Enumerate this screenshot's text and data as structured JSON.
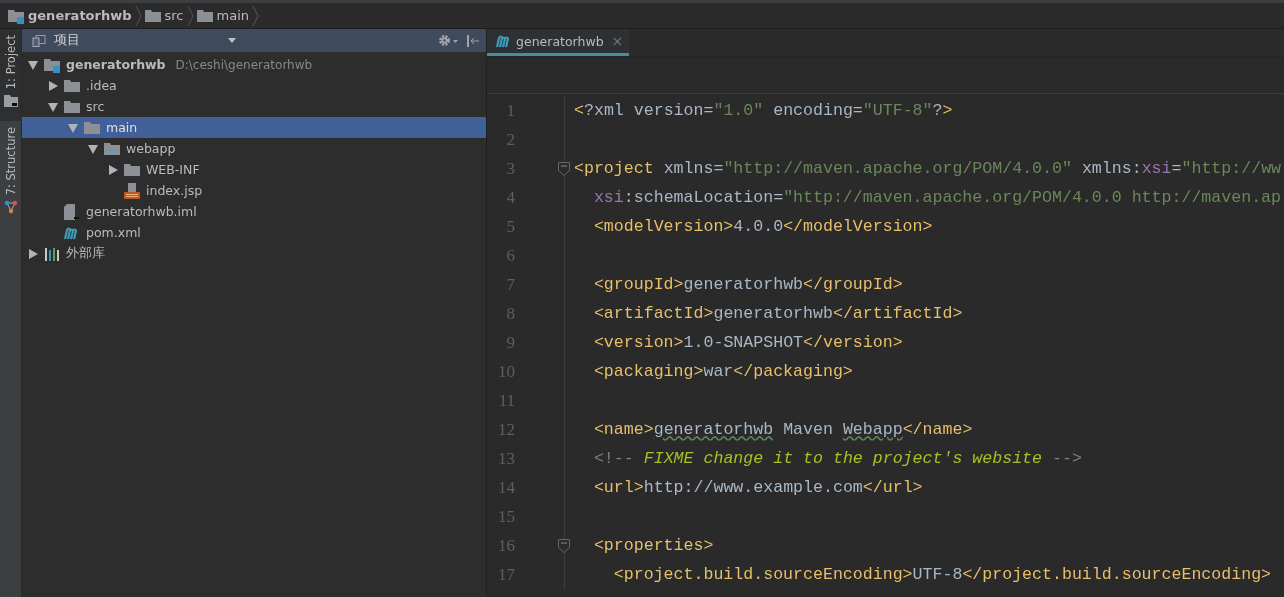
{
  "breadcrumbs": [
    {
      "label": "generatorhwb",
      "kind": "module"
    },
    {
      "label": "src",
      "kind": "folder"
    },
    {
      "label": "main",
      "kind": "folder"
    }
  ],
  "tool_stripe": [
    {
      "label": "1: Project",
      "kind": "project",
      "selected": true
    },
    {
      "label": "7: Structure",
      "kind": "structure",
      "selected": false
    }
  ],
  "project_panel": {
    "title": "项目",
    "tree": [
      {
        "label": "generatorhwb",
        "path": "D:\\ceshi\\generatorhwb",
        "kind": "module",
        "expanded": true,
        "selected": false,
        "children": [
          {
            "label": ".idea",
            "kind": "folder",
            "expanded": false,
            "selected": false
          },
          {
            "label": "src",
            "kind": "folder",
            "expanded": true,
            "selected": false,
            "children": [
              {
                "label": "main",
                "kind": "folder",
                "expanded": true,
                "selected": true,
                "children": [
                  {
                    "label": "webapp",
                    "kind": "webfolder",
                    "expanded": true,
                    "selected": false,
                    "children": [
                      {
                        "label": "WEB-INF",
                        "kind": "folder",
                        "expanded": false,
                        "selected": false
                      },
                      {
                        "label": "index.jsp",
                        "kind": "jsp",
                        "selected": false
                      }
                    ]
                  }
                ]
              }
            ]
          },
          {
            "label": "generatorhwb.iml",
            "kind": "file",
            "selected": false
          },
          {
            "label": "pom.xml",
            "kind": "maven",
            "selected": false
          }
        ]
      },
      {
        "label": "外部库",
        "kind": "library",
        "expanded": false,
        "selected": false
      }
    ]
  },
  "editor": {
    "tabs": [
      {
        "label": "generatorhwb",
        "close": "×",
        "selected": true
      }
    ],
    "lines": [
      {
        "number": "1",
        "tokens": [
          {
            "kind": "tag",
            "text": "<"
          },
          {
            "kind": "text",
            "text": "?xml version="
          },
          {
            "kind": "str",
            "text": "\"1.0\""
          },
          {
            "kind": "text",
            "text": " encoding="
          },
          {
            "kind": "str",
            "text": "\"UTF-8\""
          },
          {
            "kind": "text",
            "text": "?"
          },
          {
            "kind": "tag",
            "text": ">"
          }
        ]
      },
      {
        "number": "2"
      },
      {
        "number": "3",
        "fold": true,
        "tokens": [
          {
            "kind": "tag",
            "text": "<project"
          },
          {
            "kind": "text",
            "text": " xmlns="
          },
          {
            "kind": "str",
            "text": "\"http://maven.apache.org/POM/4.0.0\""
          },
          {
            "kind": "text",
            "text": " xmlns:"
          },
          {
            "kind": "ns",
            "text": "xsi"
          },
          {
            "kind": "text",
            "text": "="
          },
          {
            "kind": "str",
            "text": "\"http://ww"
          }
        ]
      },
      {
        "number": "4",
        "tokens": [
          {
            "kind": "ns",
            "text": "  xsi"
          },
          {
            "kind": "text",
            "text": ":schemaLocation="
          },
          {
            "kind": "str",
            "text": "\"http://maven.apache.org/POM/4.0.0 http://maven.ap"
          }
        ]
      },
      {
        "number": "5",
        "tokens": [
          {
            "kind": "tag",
            "text": "  <modelVersion>"
          },
          {
            "kind": "text",
            "text": "4.0.0"
          },
          {
            "kind": "tag",
            "text": "</modelVersion>"
          }
        ]
      },
      {
        "number": "6"
      },
      {
        "number": "7",
        "tokens": [
          {
            "kind": "tag",
            "text": "  <groupId>"
          },
          {
            "kind": "text",
            "text": "generatorhwb"
          },
          {
            "kind": "tag",
            "text": "</groupId>"
          }
        ]
      },
      {
        "number": "8",
        "tokens": [
          {
            "kind": "tag",
            "text": "  <artifactId>"
          },
          {
            "kind": "text",
            "text": "generatorhwb"
          },
          {
            "kind": "tag",
            "text": "</artifactId>"
          }
        ]
      },
      {
        "number": "9",
        "tokens": [
          {
            "kind": "tag",
            "text": "  <version>"
          },
          {
            "kind": "text",
            "text": "1.0-SNAPSHOT"
          },
          {
            "kind": "tag",
            "text": "</version>"
          }
        ]
      },
      {
        "number": "10",
        "tokens": [
          {
            "kind": "tag",
            "text": "  <packaging>"
          },
          {
            "kind": "text",
            "text": "war"
          },
          {
            "kind": "tag",
            "text": "</packaging>"
          }
        ]
      },
      {
        "number": "11"
      },
      {
        "number": "12",
        "tokens": [
          {
            "kind": "tag",
            "text": "  <name>"
          },
          {
            "kind": "typo",
            "text": "generatorhwb"
          },
          {
            "kind": "text",
            "text": " Maven "
          },
          {
            "kind": "typo",
            "text": "Webapp"
          },
          {
            "kind": "tag",
            "text": "</name>"
          }
        ]
      },
      {
        "number": "13",
        "tokens": [
          {
            "kind": "comment",
            "text": "  <!-- "
          },
          {
            "kind": "todo",
            "text": "FIXME change it to the project's website"
          },
          {
            "kind": "comment",
            "text": " -->"
          }
        ]
      },
      {
        "number": "14",
        "tokens": [
          {
            "kind": "tag",
            "text": "  <url>"
          },
          {
            "kind": "text",
            "text": "http://www.example.com"
          },
          {
            "kind": "tag",
            "text": "</url>"
          }
        ]
      },
      {
        "number": "15"
      },
      {
        "number": "16",
        "fold": true,
        "tokens": [
          {
            "kind": "tag",
            "text": "  <properties>"
          }
        ]
      },
      {
        "number": "17",
        "tokens": [
          {
            "kind": "tag",
            "text": "    <project.build.sourceEncoding>"
          },
          {
            "kind": "text",
            "text": "UTF-8"
          },
          {
            "kind": "tag",
            "text": "</project.build.sourceEncoding>"
          }
        ]
      }
    ]
  }
}
